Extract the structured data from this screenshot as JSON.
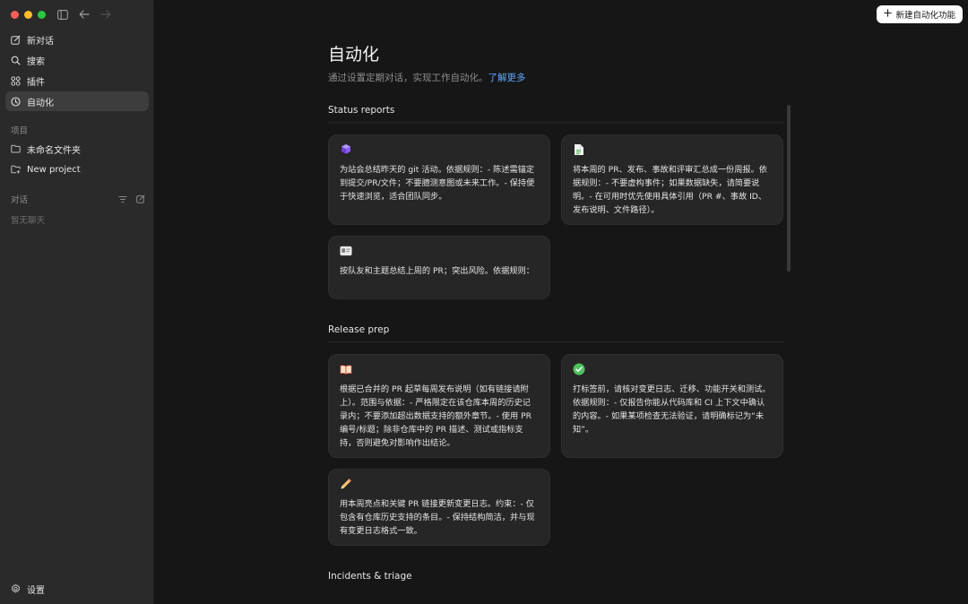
{
  "sidebar": {
    "nav": [
      {
        "label": "新对话",
        "icon": "new-chat-icon"
      },
      {
        "label": "搜索",
        "icon": "search-icon"
      },
      {
        "label": "插件",
        "icon": "plugins-icon"
      },
      {
        "label": "自动化",
        "icon": "clock-icon",
        "active": true
      }
    ],
    "projects_title": "项目",
    "projects": [
      {
        "label": "未命名文件夹",
        "icon": "folder-icon"
      },
      {
        "label": "New project",
        "icon": "new-project-icon"
      }
    ],
    "chats_title": "对话",
    "chats_empty": "暂无聊天",
    "settings_label": "设置"
  },
  "header": {
    "new_automation_label": "新建自动化功能"
  },
  "main": {
    "title": "自动化",
    "subtitle": "通过设置定期对话，实现工作自动化。",
    "learn_more": "了解更多",
    "sections": [
      {
        "title": "Status reports",
        "cards": [
          {
            "icon": "cube-icon",
            "text": "为站会总结昨天的 git 活动。依据规则：- 陈述需锚定到提交/PR/文件；不要臆测意图或未来工作。- 保持便于快速浏览，适合团队同步。"
          },
          {
            "icon": "document-icon",
            "text": "将本周的 PR、发布、事故和评审汇总成一份周报。依据规则：- 不要虚构事件；如果数据缺失，请简要说明。- 在可用时优先使用具体引用（PR #、事故 ID、发布说明、文件路径）。"
          },
          {
            "icon": "id-card-icon",
            "text": "按队友和主题总结上周的 PR；突出风险。依据规则："
          }
        ]
      },
      {
        "title": "Release prep",
        "cards": [
          {
            "icon": "book-icon",
            "text": "根据已合并的 PR 起草每周发布说明（如有链接请附上）。范围与依据：- 严格限定在该仓库本周的历史记录内；不要添加超出数据支持的额外章节。- 使用 PR 编号/标题；除非仓库中的 PR 描述、测试或指标支持，否则避免对影响作出结论。"
          },
          {
            "icon": "check-circle-icon",
            "text": "打标签前，请核对变更日志、迁移、功能开关和测试。依据规则：- 仅报告你能从代码库和 CI 上下文中确认的内容。- 如果某项检查无法验证，请明确标记为“未知”。"
          },
          {
            "icon": "pencil-icon",
            "text": "用本周亮点和关键 PR 链接更新变更日志。约束：- 仅包含有仓库历史支持的条目。- 保持结构简洁，并与现有变更日志格式一致。"
          }
        ]
      },
      {
        "title": "Incidents & triage",
        "cards": []
      }
    ]
  },
  "colors": {
    "accent_link": "#5aa7ff",
    "sidebar_bg": "#2a2a2a",
    "main_bg": "#161616",
    "card_bg": "#262626"
  }
}
